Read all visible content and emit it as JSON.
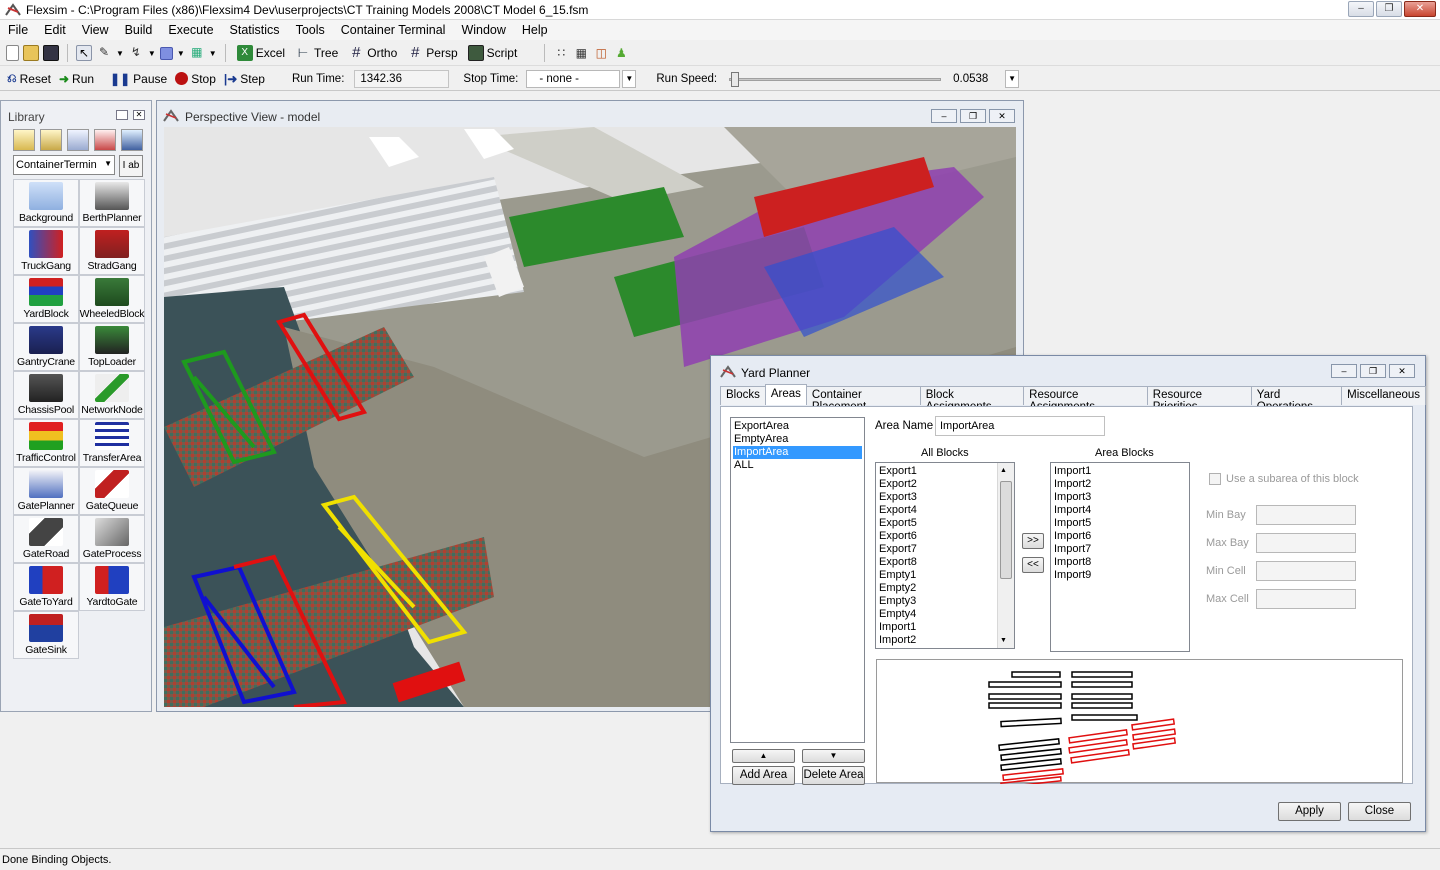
{
  "window": {
    "title": "Flexsim - C:\\Program Files (x86)\\Flexsim4 Dev\\userprojects\\CT Training Models 2008\\CT Model 6_15.fsm"
  },
  "menu": [
    "File",
    "Edit",
    "View",
    "Build",
    "Execute",
    "Statistics",
    "Tools",
    "Container Terminal",
    "Window",
    "Help"
  ],
  "toolbar": {
    "excel": "Excel",
    "tree": "Tree",
    "ortho": "Ortho",
    "persp": "Persp",
    "script": "Script"
  },
  "runbar": {
    "reset": "Reset",
    "run": "Run",
    "pause": "Pause",
    "stop": "Stop",
    "step": "Step",
    "run_time_label": "Run Time:",
    "run_time_value": "1342.36",
    "stop_time_label": "Stop Time:",
    "stop_time_value": "- none -",
    "run_speed_label": "Run Speed:",
    "run_speed_value": "0.0538"
  },
  "library": {
    "title": "Library",
    "dropdown": "ContainerTermin",
    "items": [
      {
        "label": "Background",
        "icon": "background-icon"
      },
      {
        "label": "BerthPlanner",
        "icon": "berth-planner-icon"
      },
      {
        "label": "TruckGang",
        "icon": "truck-gang-icon"
      },
      {
        "label": "StradGang",
        "icon": "strad-gang-icon"
      },
      {
        "label": "YardBlock",
        "icon": "yard-block-icon"
      },
      {
        "label": "WheeledBlock",
        "icon": "wheeled-block-icon"
      },
      {
        "label": "GantryCrane",
        "icon": "gantry-crane-icon"
      },
      {
        "label": "TopLoader",
        "icon": "top-loader-icon"
      },
      {
        "label": "ChassisPool",
        "icon": "chassis-pool-icon"
      },
      {
        "label": "NetworkNode",
        "icon": "network-node-icon"
      },
      {
        "label": "TrafficControl",
        "icon": "traffic-control-icon"
      },
      {
        "label": "TransferArea",
        "icon": "transfer-area-icon"
      },
      {
        "label": "GatePlanner",
        "icon": "gate-planner-icon"
      },
      {
        "label": "GateQueue",
        "icon": "gate-queue-icon"
      },
      {
        "label": "GateRoad",
        "icon": "gate-road-icon"
      },
      {
        "label": "GateProcess",
        "icon": "gate-process-icon"
      },
      {
        "label": "GateToYard",
        "icon": "gate-to-yard-icon"
      },
      {
        "label": "YardtoGate",
        "icon": "yard-to-gate-icon"
      },
      {
        "label": "GateSink",
        "icon": "gate-sink-icon"
      }
    ]
  },
  "perspective": {
    "title": "Perspective View - model"
  },
  "yard_planner": {
    "title": "Yard Planner",
    "tabs": [
      "Blocks",
      "Areas",
      "Container Placement",
      "Block Assignments",
      "Resource Assignments",
      "Resource Priorities",
      "Yard Operations",
      "Miscellaneous"
    ],
    "active_tab": "Areas",
    "areas": [
      "ExportArea",
      "EmptyArea",
      "ImportArea",
      "ALL"
    ],
    "selected_area": "ImportArea",
    "area_name_label": "Area Name",
    "area_name_value": "ImportArea",
    "all_blocks_label": "All Blocks",
    "all_blocks": [
      "Export1",
      "Export2",
      "Export3",
      "Export4",
      "Export5",
      "Export6",
      "Export7",
      "Export8",
      "Empty1",
      "Empty2",
      "Empty3",
      "Empty4",
      "Import1",
      "Import2"
    ],
    "area_blocks_label": "Area Blocks",
    "area_blocks": [
      "Import1",
      "Import2",
      "Import3",
      "Import4",
      "Import5",
      "Import6",
      "Import7",
      "Import8",
      "Import9"
    ],
    "add_btn": ">>",
    "remove_btn": "<<",
    "subarea_label": "Use a subarea of this block",
    "min_bay": "Min Bay",
    "max_bay": "Max Bay",
    "min_cell": "Min Cell",
    "max_cell": "Max Cell",
    "add_area": "Add Area",
    "delete_area": "Delete Area",
    "apply": "Apply",
    "close": "Close"
  },
  "status": "Done Binding Objects.",
  "colors": {
    "accent_select": "#3399ff",
    "crane_green": "#1e9a1e",
    "crane_red": "#e01010",
    "crane_yellow": "#f0e000",
    "crane_blue": "#1010d0"
  }
}
